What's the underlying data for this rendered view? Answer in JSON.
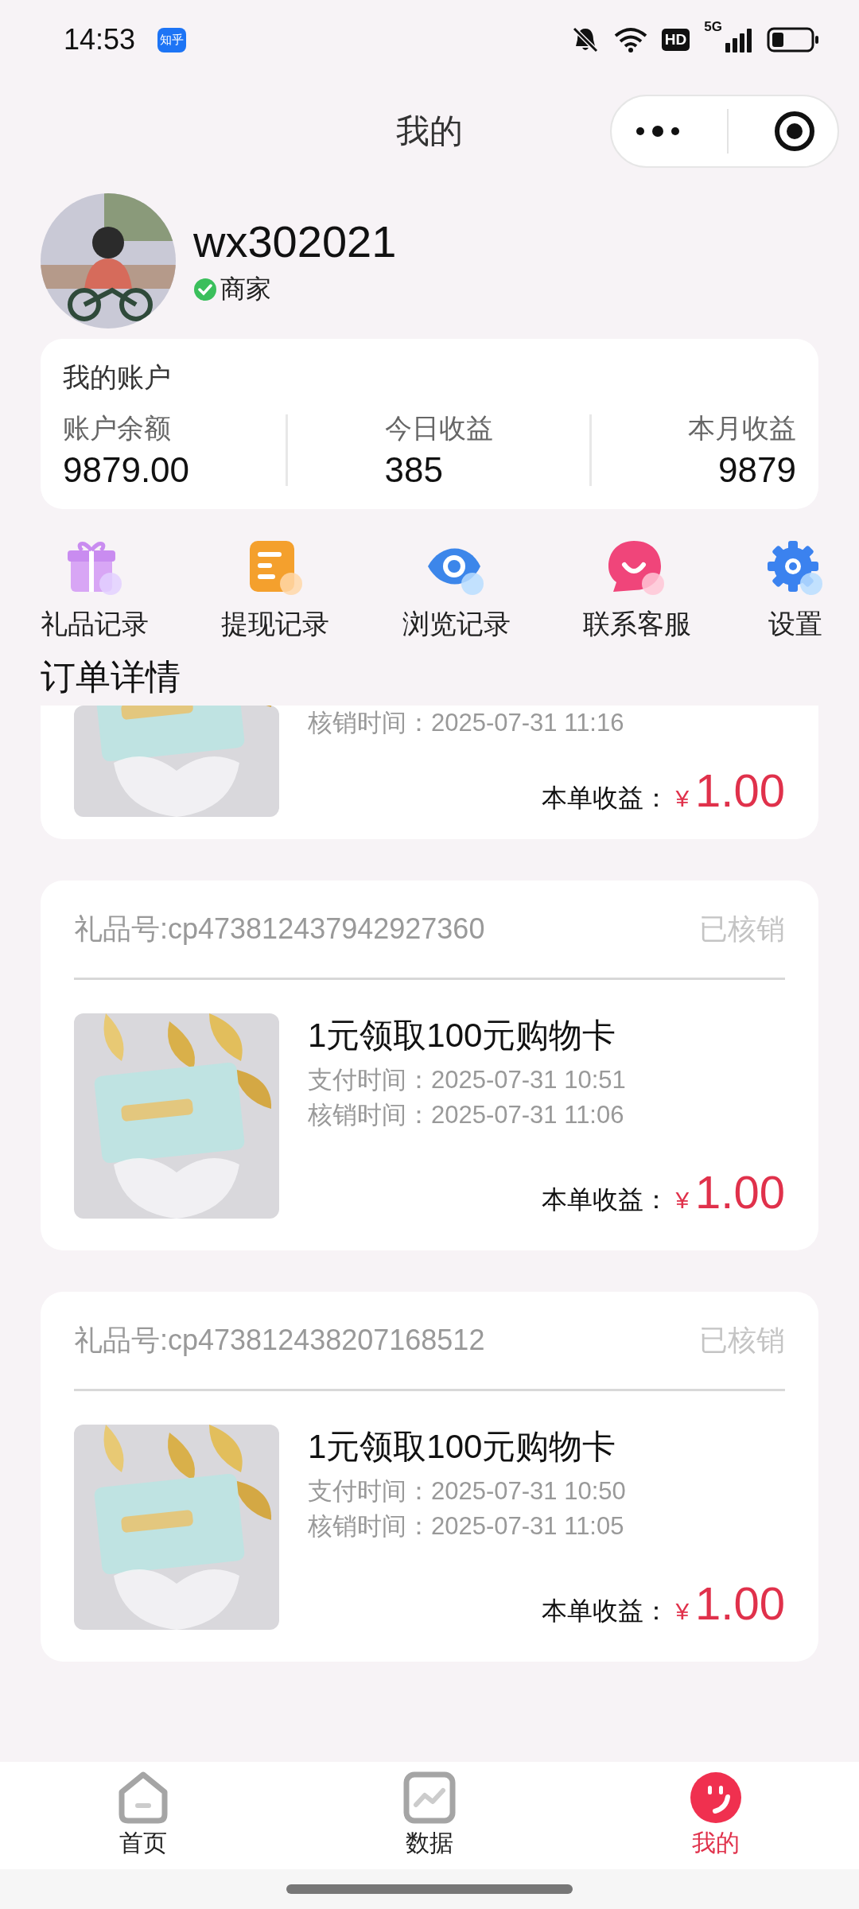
{
  "status_bar": {
    "time": "14:53",
    "app_badge": "知乎",
    "network_badge": "HD",
    "network_type": "5G"
  },
  "header": {
    "title": "我的"
  },
  "profile": {
    "name": "wx302021",
    "role": "商家",
    "verified": true
  },
  "account": {
    "title": "我的账户",
    "stats": [
      {
        "label": "账户余额",
        "value": "9879.00"
      },
      {
        "label": "今日收益",
        "value": "385"
      },
      {
        "label": "本月收益",
        "value": "9879"
      }
    ]
  },
  "shortcuts": [
    {
      "label": "礼品记录",
      "kind": "gift"
    },
    {
      "label": "提现记录",
      "kind": "notes"
    },
    {
      "label": "浏览记录",
      "kind": "eye"
    },
    {
      "label": "联系客服",
      "kind": "chat"
    },
    {
      "label": "设置",
      "kind": "gear"
    }
  ],
  "orders": {
    "title": "订单详情",
    "items": [
      {
        "kind": "partial",
        "verify_time": "核销时间：2025-07-31 11:16",
        "earnings_label": "本单收益：",
        "currency": "¥",
        "amount": "1.00"
      },
      {
        "kind": "full",
        "gift_no": "礼品号:cp473812437942927360",
        "status": "已核销",
        "product": "1元领取100元购物卡",
        "pay_time": "支付时间：2025-07-31 10:51",
        "verify_time": "核销时间：2025-07-31 11:06",
        "earnings_label": "本单收益：",
        "currency": "¥",
        "amount": "1.00"
      },
      {
        "kind": "full",
        "gift_no": "礼品号:cp473812438207168512",
        "status": "已核销",
        "product": "1元领取100元购物卡",
        "pay_time": "支付时间：2025-07-31 10:50",
        "verify_time": "核销时间：2025-07-31 11:05",
        "earnings_label": "本单收益：",
        "currency": "¥",
        "amount": "1.00"
      }
    ]
  },
  "tab_bar": [
    {
      "label": "首页",
      "kind": "home",
      "selected": false
    },
    {
      "label": "数据",
      "kind": "chart",
      "selected": false
    },
    {
      "label": "我的",
      "kind": "smile",
      "selected": true
    }
  ]
}
